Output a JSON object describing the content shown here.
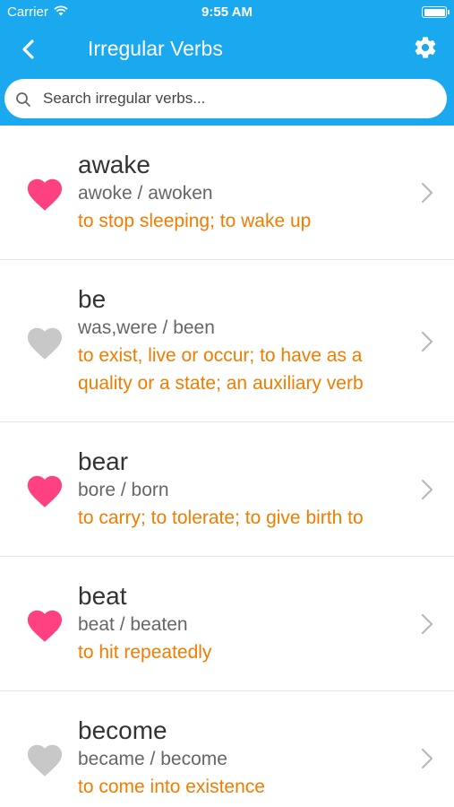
{
  "status_bar": {
    "carrier": "Carrier",
    "time": "9:55 AM"
  },
  "nav": {
    "title": "Irregular Verbs"
  },
  "search": {
    "placeholder": "Search irregular verbs..."
  },
  "colors": {
    "header": "#1aa8ee",
    "favorite": "#ff4081",
    "not_favorite": "#c8c8c8",
    "definition": "#f07c00"
  },
  "verbs": [
    {
      "word": "awake",
      "forms": "awoke / awoken",
      "definition": "to stop sleeping; to wake up",
      "favorite": true
    },
    {
      "word": "be",
      "forms": "was,were / been",
      "definition": "to exist, live or occur; to have as a quality or a state; an auxiliary verb",
      "favorite": false
    },
    {
      "word": "bear",
      "forms": "bore / born",
      "definition": "to carry; to tolerate; to give birth to",
      "favorite": true
    },
    {
      "word": "beat",
      "forms": "beat / beaten",
      "definition": "to hit repeatedly",
      "favorite": true
    },
    {
      "word": "become",
      "forms": "became / become",
      "definition": "to come into existence",
      "favorite": false
    }
  ]
}
